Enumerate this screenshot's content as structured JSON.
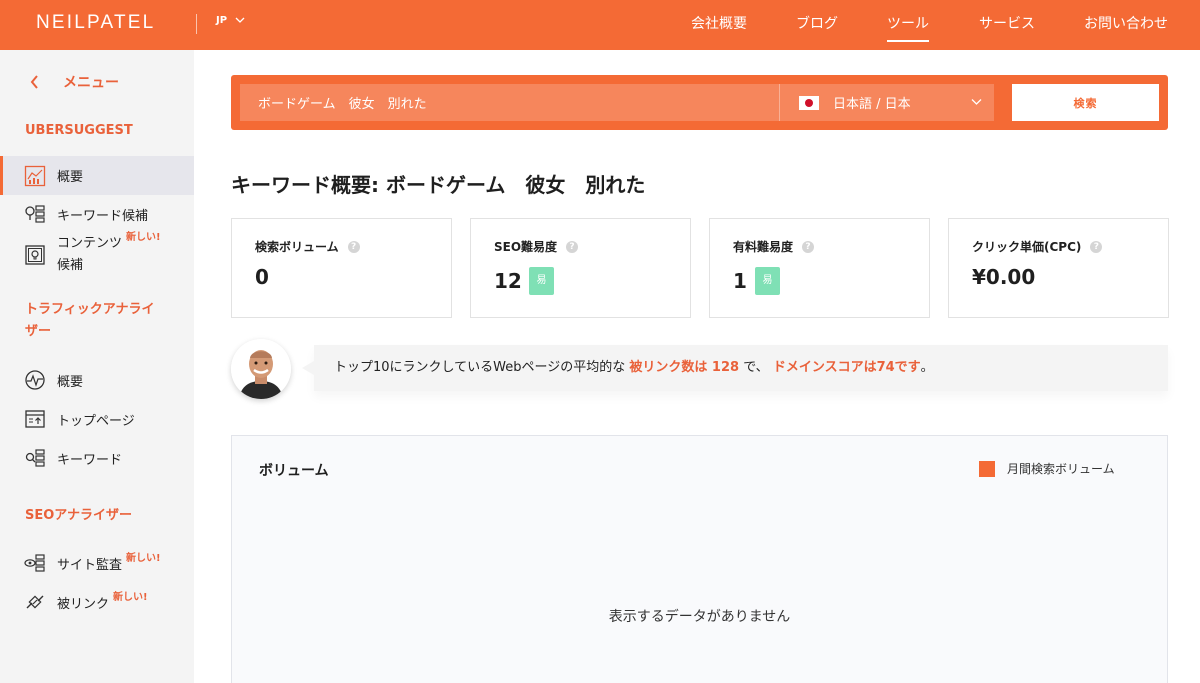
{
  "topnav": {
    "brand": "NEILPATEL",
    "lang": "JP",
    "links": [
      "会社概要",
      "ブログ",
      "ツール",
      "サービス",
      "お問い合わせ"
    ],
    "active_link": "ツール"
  },
  "sidebar": {
    "menu_label": "メニュー",
    "ubersuggest": {
      "title": "UBERSUGGEST",
      "items": [
        {
          "label": "概要",
          "icon": "chart-icon"
        },
        {
          "label": "キーワード候補",
          "icon": "keyword-ideas-icon"
        },
        {
          "label_line1": "コンテンツ",
          "label_line2": "候補",
          "badge": "新しい!",
          "icon": "bulb-icon"
        }
      ]
    },
    "traffic": {
      "title_line1": "トラフィックアナライ",
      "title_line2": "ザー",
      "items": [
        {
          "label": "概要",
          "icon": "pulse-icon"
        },
        {
          "label": "トップページ",
          "icon": "top-page-icon"
        },
        {
          "label": "キーワード",
          "icon": "keyword-search-icon"
        }
      ]
    },
    "seo": {
      "title": "SEOアナライザー",
      "items": [
        {
          "label": "サイト監査",
          "badge": "新しい!",
          "icon": "eye-list-icon"
        },
        {
          "label": "被リンク",
          "badge": "新しい!",
          "icon": "link-icon"
        }
      ]
    }
  },
  "search": {
    "keyword": "ボードゲーム　彼女　別れた",
    "language": "日本語 / 日本",
    "button": "検索"
  },
  "title": {
    "prefix": "キーワード概要:",
    "keyword": " ボードゲーム　彼女　別れた"
  },
  "metrics": [
    {
      "label": "検索ボリューム",
      "value": "0"
    },
    {
      "label": "SEO難易度",
      "value": "12",
      "badge": "易"
    },
    {
      "label": "有料難易度",
      "value": "1",
      "badge": "易"
    },
    {
      "label": "クリック単価(CPC)",
      "value": "¥0.00"
    }
  ],
  "tip": {
    "part1": "トップ10にランクしているWebページの平均的な",
    "hl1": "被リンク数は 128",
    "part2": "で、",
    "hl2": "ドメインスコアは74です",
    "part3": "。"
  },
  "volume": {
    "title": "ボリューム",
    "legend": "月間検索ボリューム",
    "empty": "表示するデータがありません"
  },
  "colors": {
    "brand": "#f46a35",
    "accent_text": "#e9613a",
    "easy_badge": "#7fe0b5"
  }
}
